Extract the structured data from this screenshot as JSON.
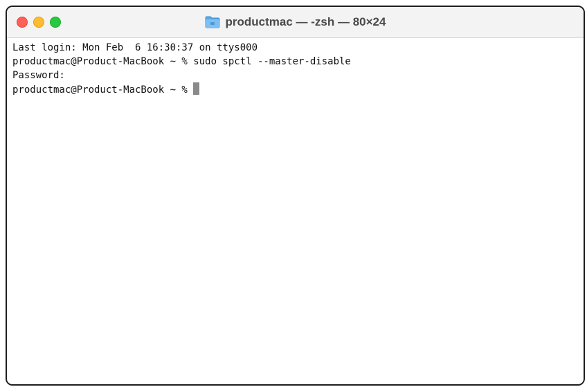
{
  "window": {
    "title": "productmac — -zsh — 80×24",
    "title_icon": "folder-icon",
    "controls": {
      "close_color": "#ff5f57",
      "minimize_color": "#febc2e",
      "zoom_color": "#28c840"
    }
  },
  "terminal": {
    "lines": [
      "Last login: Mon Feb  6 16:30:37 on ttys000",
      "productmac@Product-MacBook ~ % sudo spctl --master-disable",
      "Password:",
      "productmac@Product-MacBook ~ % "
    ]
  }
}
